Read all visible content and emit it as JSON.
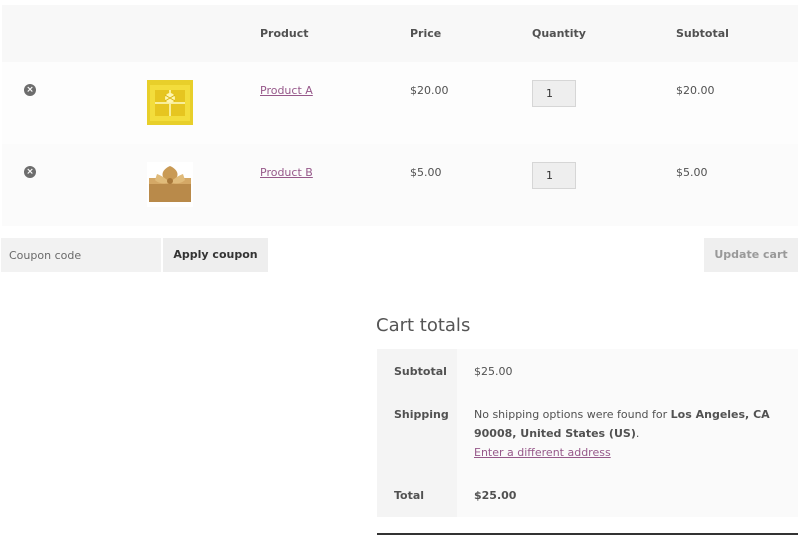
{
  "cart": {
    "headers": {
      "product": "Product",
      "price": "Price",
      "quantity": "Quantity",
      "subtotal": "Subtotal"
    },
    "items": [
      {
        "remove_icon": "remove-circle-icon",
        "name": "Product A",
        "price": "$20.00",
        "quantity": "1",
        "subtotal": "$20.00"
      },
      {
        "remove_icon": "remove-circle-icon",
        "name": "Product B",
        "price": "$5.00",
        "quantity": "1",
        "subtotal": "$5.00"
      }
    ]
  },
  "actions": {
    "coupon_placeholder": "Coupon code",
    "apply_coupon": "Apply coupon",
    "update_cart": "Update cart"
  },
  "totals": {
    "title": "Cart totals",
    "subtotal_label": "Subtotal",
    "subtotal_value": "$25.00",
    "shipping_label": "Shipping",
    "shipping_text_prefix": "No shipping options were found for ",
    "shipping_location": "Los Angeles, CA 90008, United States (US)",
    "shipping_text_suffix": ".",
    "shipping_link": "Enter a different address",
    "total_label": "Total",
    "total_value": "$25.00"
  },
  "colors": {
    "link": "#96588a",
    "text": "#515151",
    "header_bg": "#f8f8f8"
  }
}
